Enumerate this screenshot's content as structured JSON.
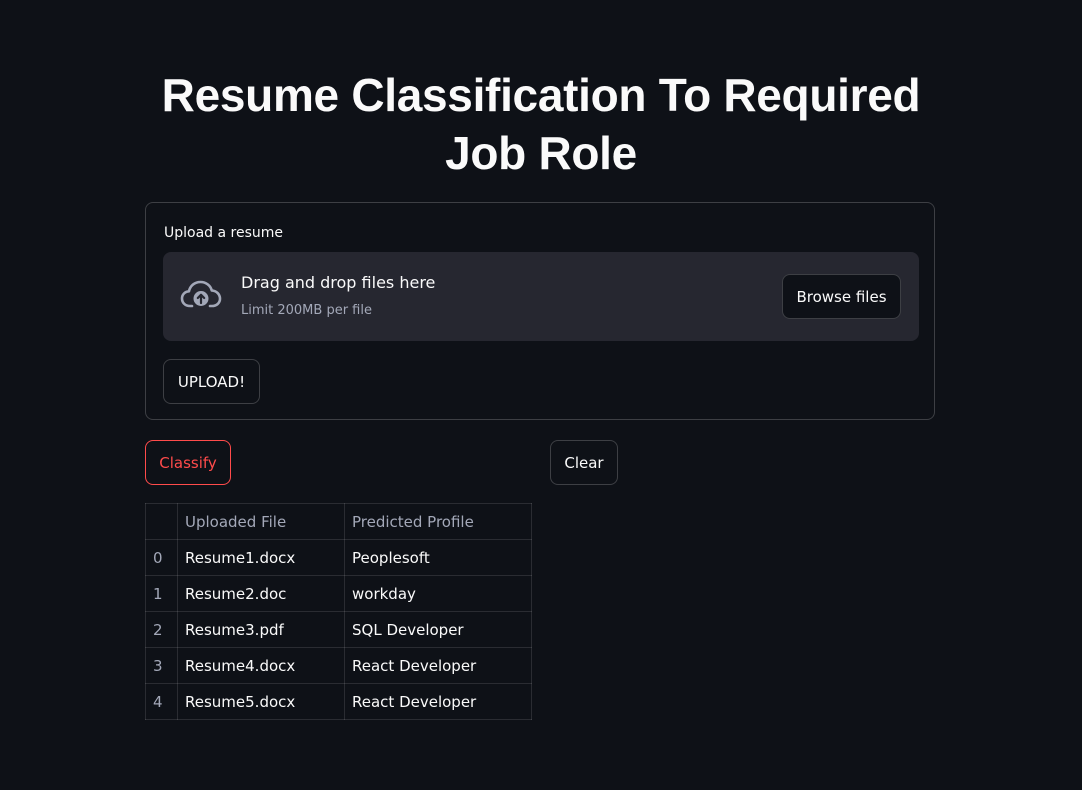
{
  "page": {
    "title": "Resume Classification To Required Job Role"
  },
  "uploader": {
    "label": "Upload a resume",
    "drop_text": "Drag and drop files here",
    "limit_text": "Limit 200MB per file",
    "browse_label": "Browse files",
    "icon": "cloud-upload-icon",
    "upload_label": "UPLOAD!"
  },
  "actions": {
    "classify_label": "Classify",
    "clear_label": "Clear"
  },
  "results_table": {
    "columns": [
      "",
      "Uploaded File",
      "Predicted Profile"
    ],
    "rows": [
      {
        "index": "0",
        "file": "Resume1.docx",
        "profile": "Peoplesoft"
      },
      {
        "index": "1",
        "file": "Resume2.doc",
        "profile": "workday"
      },
      {
        "index": "2",
        "file": "Resume3.pdf",
        "profile": "SQL Developer"
      },
      {
        "index": "3",
        "file": "Resume4.docx",
        "profile": "React Developer"
      },
      {
        "index": "4",
        "file": "Resume5.docx",
        "profile": "React Developer"
      }
    ]
  },
  "colors": {
    "background": "#0e1117",
    "surface": "#262730",
    "text": "#fafafa",
    "muted": "#a3a8b8",
    "accent": "#ff4b4b"
  }
}
